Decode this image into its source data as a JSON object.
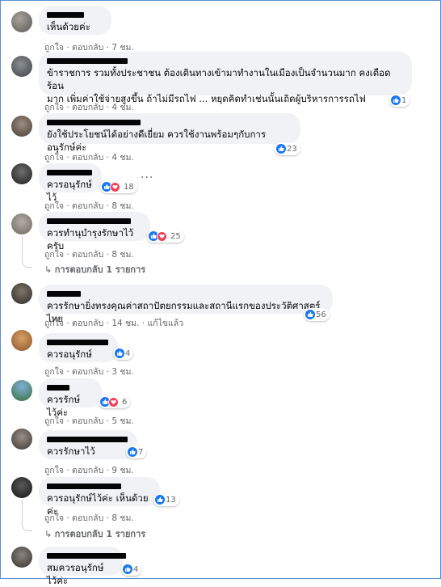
{
  "labels": {
    "like": "ถูกใจ",
    "reply": "ตอบกลับ",
    "edited": "แก้ไขแล้ว",
    "sep": "·"
  },
  "comments": [
    {
      "text": "เห็นด้วยค่ะ",
      "time": "7 ชม.",
      "reactions": null
    },
    {
      "text": "ข้าราชการ รวมทั้งประชาชน ต้องเดินทางเข้ามาทำงานในเมืองเป็นจำนวนมาก คงเดือดร้อน\nมาก เพิ่มค่าใช้จ่ายสูงขึ้น ถ้าไม่มีรถไฟ ... หยุดคิดทำเช่นนั้นเถิดผู้บริหารการรถไฟ",
      "time": "4 ชม.",
      "reactions": "1"
    },
    {
      "text": "ยังใช้ประโยชน์ได้อย่างดีเยี่ยม ควรใช้งานพร้อมๆกับการอนุรักษ์ค่ะ",
      "time": "4 ชม.",
      "reactions": "23"
    },
    {
      "text": "ควรอนุรักษ์ไว้",
      "time": "8 ชม.",
      "reactions": "18"
    },
    {
      "text": "ควรทำนุบำรุงรักษาไว้ครับ",
      "time": "8 ชม.",
      "reactions": "25",
      "replies": "การตอบกลับ 1 รายการ"
    },
    {
      "text": "ควรรักษายิ่งทรงคุณค่าสถาปัตยกรรมและสถานีแรกของประวัติศาสตร์ไทย",
      "time": "14 ชม.",
      "reactions": "56",
      "edited": true
    },
    {
      "text": "ควรอนุรักษ์",
      "time": "3 ชม.",
      "reactions": "4"
    },
    {
      "text": "ควรรักษ์ ไว้ค่ะ",
      "time": "5 ชม.",
      "reactions": "6"
    },
    {
      "text": "ควรรักษาไว้",
      "time": "9 ชม.",
      "reactions": "7"
    },
    {
      "text": "ควรอนุรักษ์ไว้ค่ะ เห็นด้วยค่ะ",
      "time": "8 ชม.",
      "reactions": "13",
      "replies": "การตอบกลับ 1 รายการ"
    },
    {
      "text": "สมควรอนุรักษ์ไว้ค่ะ",
      "time": "",
      "reactions": "4"
    }
  ],
  "icons": {
    "like": "thumbs-up-icon",
    "love": "heart-icon",
    "more": "more-options-icon",
    "reply_arrow": "reply-arrow-icon"
  },
  "colors": {
    "like": "#1877f2",
    "love": "#f33e58",
    "bubble": "#f0f2f5",
    "meta": "#65676b"
  }
}
